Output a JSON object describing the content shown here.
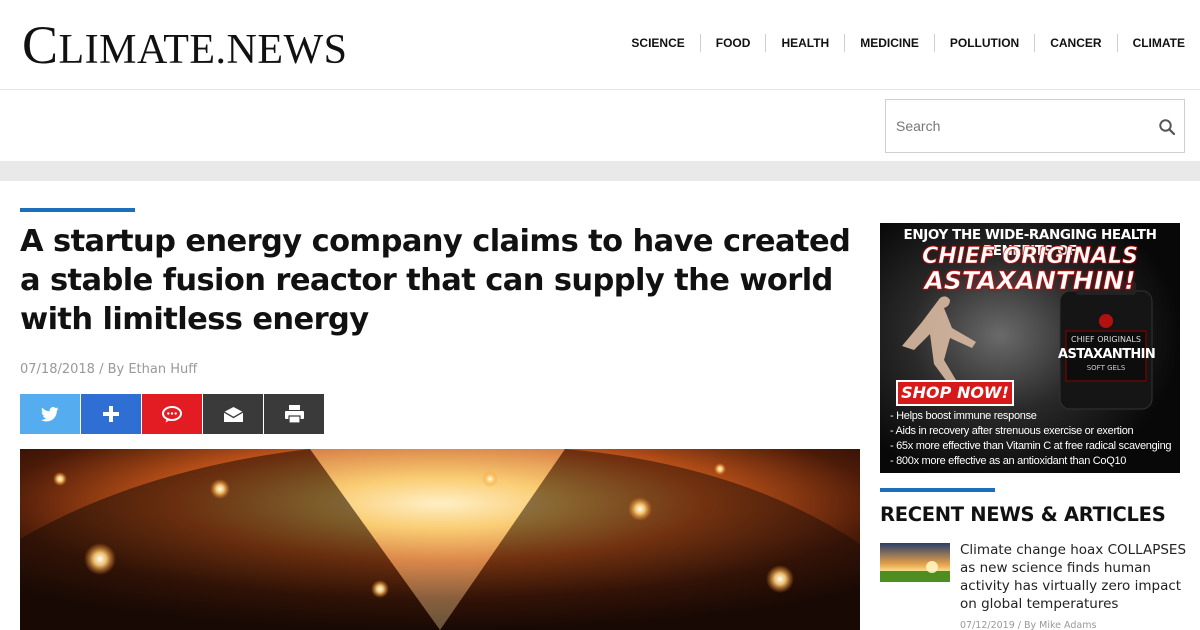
{
  "site": {
    "logo_cap": "C",
    "logo_rest": "LIMATE.NEWS"
  },
  "nav": {
    "items": [
      "SCIENCE",
      "FOOD",
      "HEALTH",
      "MEDICINE",
      "POLLUTION",
      "CANCER",
      "CLIMATE"
    ]
  },
  "search": {
    "placeholder": "Search",
    "icon": "search-icon"
  },
  "article": {
    "headline": "A startup energy company claims to have created a stable fusion reactor that can supply the world with limitless energy",
    "date": "07/18/2018",
    "separator": " / By ",
    "author": "Ethan Huff",
    "share_buttons": [
      {
        "name": "twitter",
        "icon": "twitter-icon",
        "color": "#55acee"
      },
      {
        "name": "more",
        "icon": "plus-icon",
        "color": "#2f6fd3"
      },
      {
        "name": "comment",
        "icon": "comment-icon",
        "color": "#e31b23"
      },
      {
        "name": "email",
        "icon": "envelope-icon",
        "color": "#3a3a3a"
      },
      {
        "name": "print",
        "icon": "printer-icon",
        "color": "#3a3a3a"
      }
    ]
  },
  "ad": {
    "top_line": "ENJOY THE WIDE-RANGING HEALTH BENEFITS OF",
    "brand": "CHIEF ORIGINALS",
    "product": "ASTAXANTHIN!",
    "bottle_brand": "CHIEF ORIGINALS",
    "bottle_product": "ASTAXANTHIN",
    "bottle_sub": "SOFT GELS",
    "cta": "SHOP NOW!",
    "bullets": [
      "- Helps boost immune response",
      "- Aids in recovery after strenuous exercise or exertion",
      "- 65x more effective than Vitamin C at free radical scavenging",
      "- 800x more effective as an antioxidant than CoQ10"
    ]
  },
  "sidebar": {
    "heading": "RECENT NEWS & ARTICLES",
    "items": [
      {
        "title": "Climate change hoax COLLAPSES as new science finds human activity has virtually zero impact on global temperatures",
        "date": "07/12/2019",
        "separator": " / By ",
        "author": "Mike Adams"
      }
    ]
  },
  "colors": {
    "accent": "#1e6fb9",
    "band": "#e9e9e9",
    "ad_red": "#d61a1a"
  }
}
